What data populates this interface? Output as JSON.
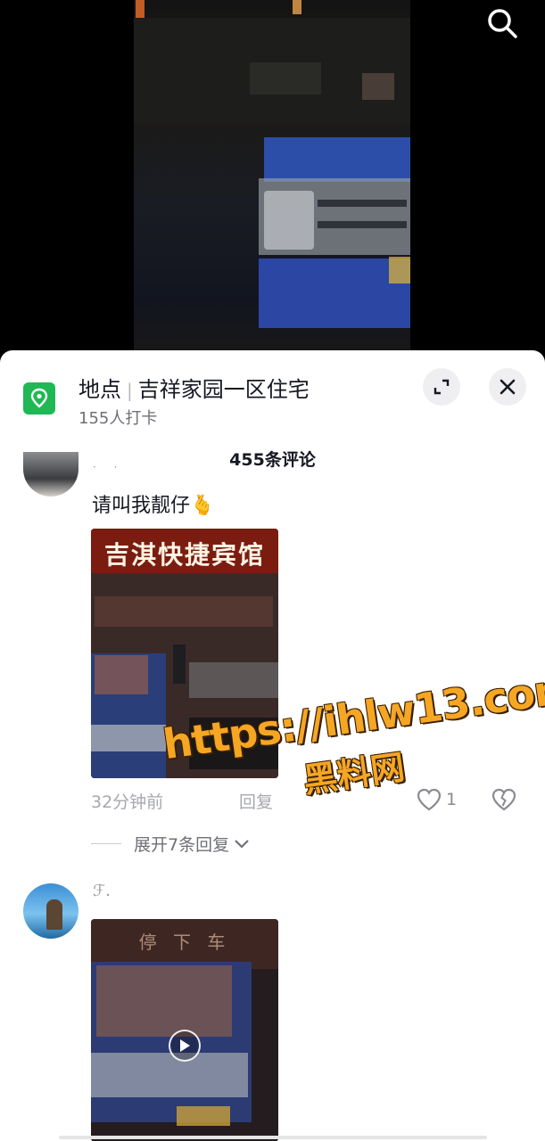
{
  "header": {
    "search_icon": "search-icon"
  },
  "location": {
    "label": "地点",
    "name": "吉祥家园一区住宅",
    "checkins": "155人打卡",
    "icon": "map-pin-icon",
    "icon_color": "#1fb854"
  },
  "sheet_controls": {
    "expand_icon": "expand-icon",
    "close_icon": "close-icon"
  },
  "comments_header": {
    "count_label": "455条评论"
  },
  "comments": [
    {
      "username": "· ·",
      "text": "请叫我靓仔",
      "emoji": "🫰",
      "image_caption": "吉淇快捷宾馆",
      "time": "32分钟前",
      "reply_label": "回复",
      "likes": "1",
      "expand_replies": "展开7条回复"
    },
    {
      "username": "ℱ.",
      "video_caption": "停 下 车"
    }
  ],
  "watermark": {
    "url": "https://ihlw13.com",
    "name": "黑料网"
  }
}
